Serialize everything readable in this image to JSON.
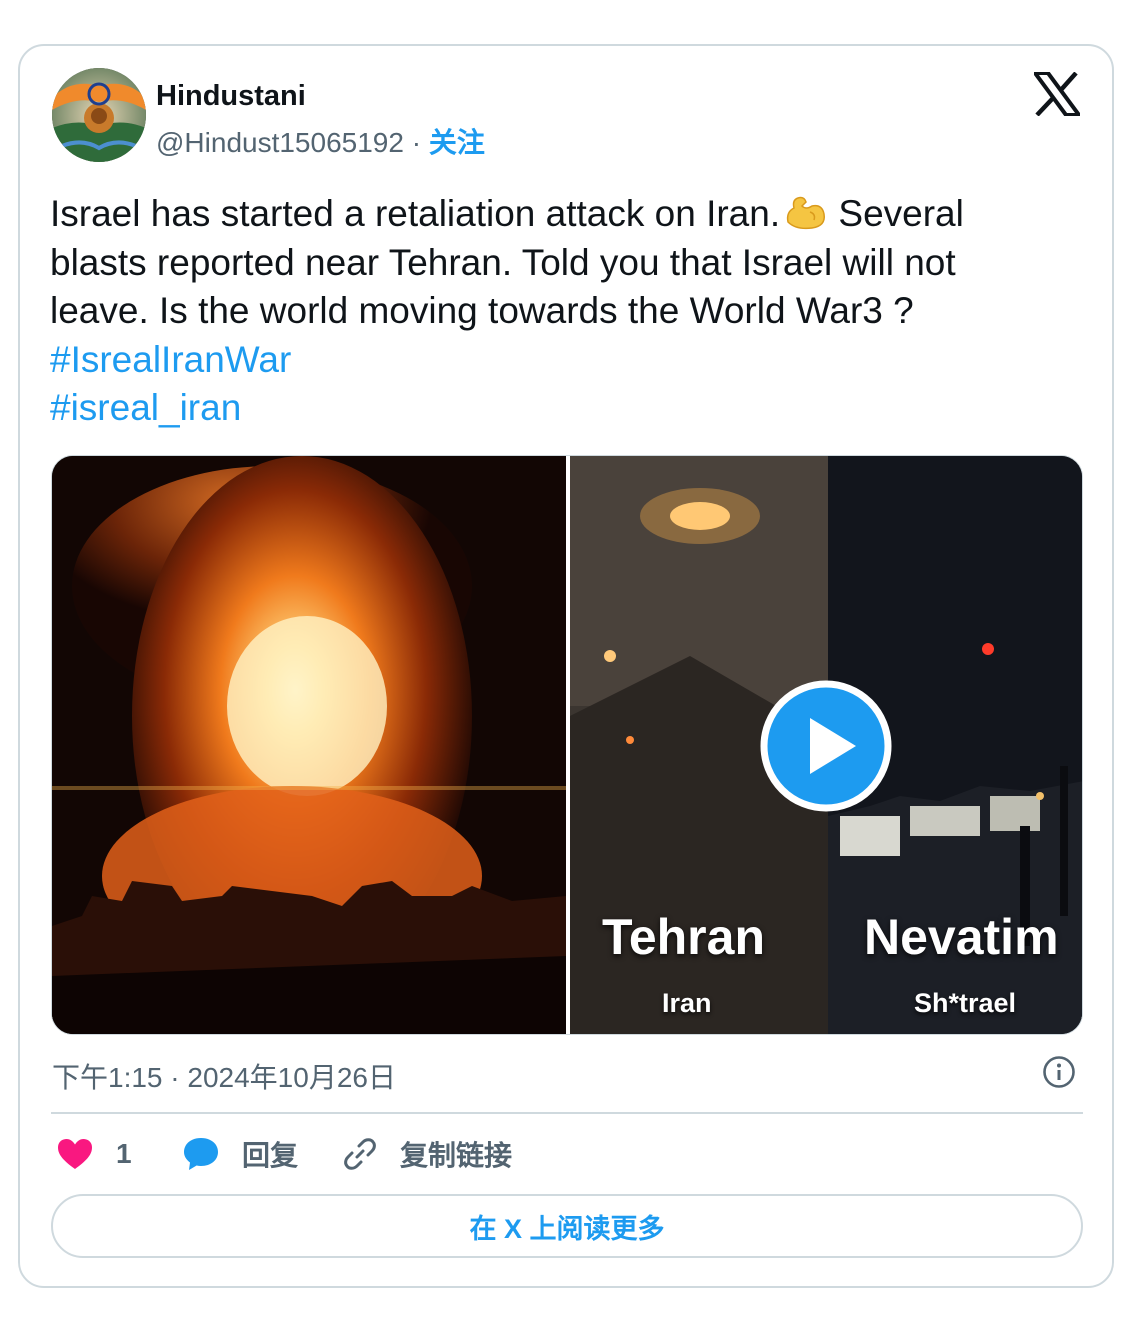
{
  "author": {
    "name": "Hindustani",
    "handle": "@Hindust15065192",
    "separator": "·",
    "follow_label": "关注"
  },
  "tweet": {
    "line1_a": "Israel has started a retaliation attack on Iran.",
    "line1_b": " Several",
    "line2": "blasts reported near Tehran.  Told you that Israel will not",
    "line3": "leave. Is the world moving towards the  World War3 ?",
    "hashtags": [
      "#IsrealIranWar",
      "#isreal_iran"
    ],
    "emoji": "flexed-biceps"
  },
  "media": {
    "left_caption_city": "Tehran",
    "left_caption_country": "Iran",
    "right_caption_city": "Nevatim",
    "right_caption_country": "Sh*trael"
  },
  "meta": {
    "timestamp": "下午1:15 · 2024年10月26日"
  },
  "actions": {
    "like_count": "1",
    "reply_label": "回复",
    "copy_link_label": "复制链接"
  },
  "read_more_label": "在 X 上阅读更多",
  "colors": {
    "accent": "#1d9bf0",
    "like": "#f91880",
    "muted": "#536471",
    "border": "#cfd9de"
  }
}
